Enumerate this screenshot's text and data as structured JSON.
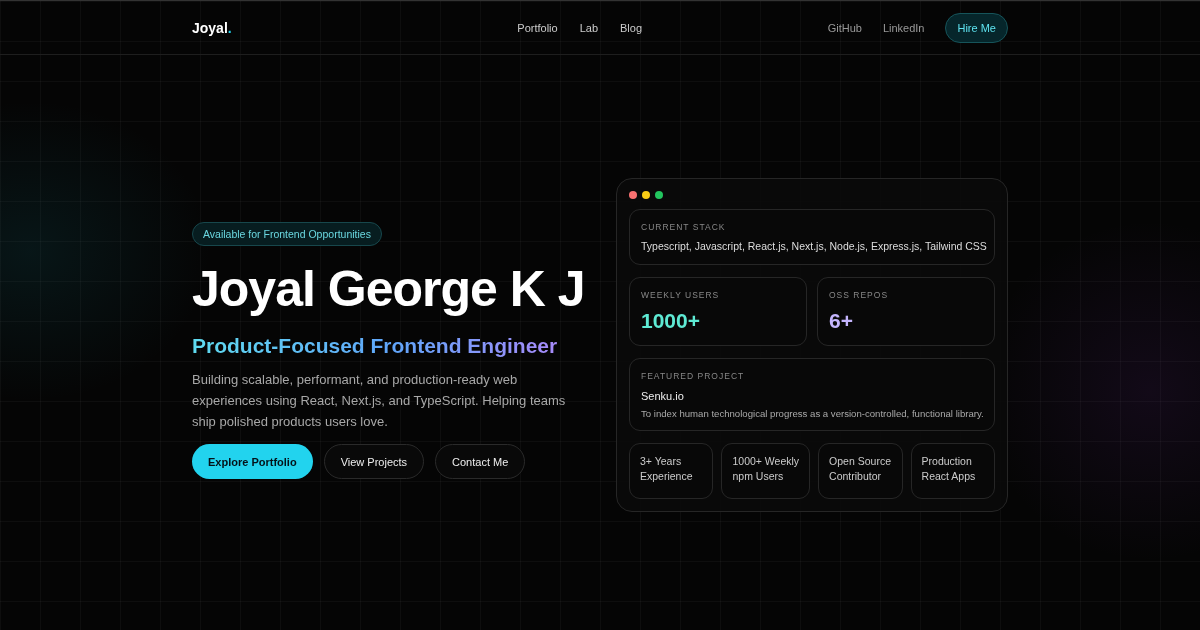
{
  "brand": {
    "name": "Joyal",
    "mark": "."
  },
  "nav": {
    "links": [
      "Portfolio",
      "Lab",
      "Blog"
    ],
    "social": [
      "GitHub",
      "LinkedIn"
    ],
    "cta": "Hire Me"
  },
  "hero": {
    "badge": "Available for Frontend Opportunities",
    "title": "Joyal George K J",
    "subtitle": "Product-Focused Frontend Engineer",
    "description": "Building scalable, performant, and production-ready web experiences using React, Next.js, and TypeScript. Helping teams ship polished products users love.",
    "buttons": [
      {
        "label": "Explore Portfolio",
        "kind": "primary"
      },
      {
        "label": "View Projects",
        "kind": "secondary"
      },
      {
        "label": "Contact Me",
        "kind": "secondary"
      }
    ]
  },
  "card": {
    "dots": [
      {
        "color": "#f87171"
      },
      {
        "color": "#facc15"
      },
      {
        "color": "#22c55e"
      }
    ],
    "stack": {
      "label": "CURRENT STACK",
      "value": "Typescript, Javascript, React.js, Next.js, Node.js, Express.js, Tailwind CSS"
    },
    "stats": [
      {
        "label": "WEEKLY USERS",
        "value": "1000+",
        "color": "#5eead4"
      },
      {
        "label": "OSS REPOS",
        "value": "6+",
        "color": "#c4b5fd"
      }
    ],
    "featured": {
      "label": "FEATURED PROJECT",
      "name": "Senku.io",
      "description": "To index human technological progress as a version-controlled, functional library."
    },
    "highlights": [
      [
        "3+ Years",
        "Experience"
      ],
      [
        "1000+ Weekly",
        "npm Users"
      ],
      [
        "Open Source",
        "Contributor"
      ],
      [
        "Production",
        "React Apps"
      ]
    ]
  }
}
